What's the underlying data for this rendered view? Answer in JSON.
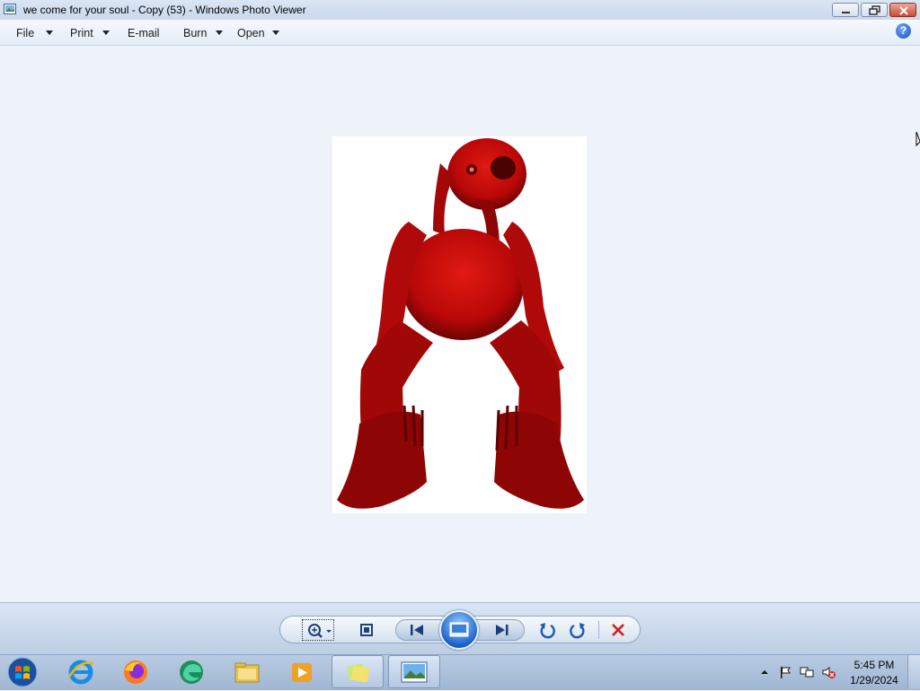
{
  "window": {
    "title": "we come for your soul - Copy (53) - Windows Photo Viewer",
    "icon": "photo-viewer-icon"
  },
  "menu": {
    "items": [
      {
        "label": "File",
        "has_dropdown": true
      },
      {
        "label": "Print",
        "has_dropdown": true
      },
      {
        "label": "E-mail",
        "has_dropdown": false
      },
      {
        "label": "Burn",
        "has_dropdown": true
      },
      {
        "label": "Open",
        "has_dropdown": true
      }
    ],
    "help_label": "?"
  },
  "controls": {
    "icons": [
      "zoom-icon",
      "actual-size-icon",
      "previous-icon",
      "slideshow-icon",
      "next-icon",
      "rotate-counterclockwise-icon",
      "rotate-clockwise-icon",
      "delete-icon"
    ]
  },
  "taskbar": {
    "pinned": [
      "internet-explorer-icon",
      "firefox-icon",
      "edge-icon",
      "file-explorer-icon",
      "media-player-icon",
      "sticky-notes-icon",
      "photo-viewer-icon"
    ],
    "tray": [
      "show-hidden-icons-icon",
      "action-center-flag-icon",
      "network-icon",
      "volume-muted-icon"
    ],
    "time": "5:45 PM",
    "date": "1/29/2024"
  },
  "colors": {
    "accent": "#1b63c9",
    "figure": "#c40a0a",
    "close": "#c94a35"
  }
}
